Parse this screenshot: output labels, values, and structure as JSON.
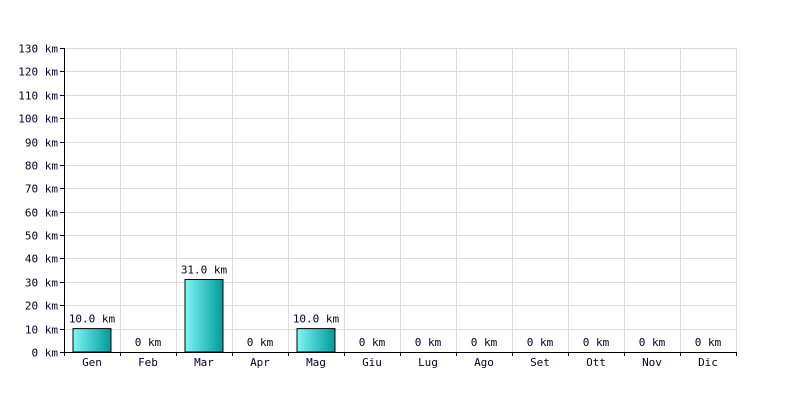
{
  "chart_data": {
    "type": "bar",
    "categories": [
      "Gen",
      "Feb",
      "Mar",
      "Apr",
      "Mag",
      "Giu",
      "Lug",
      "Ago",
      "Set",
      "Ott",
      "Nov",
      "Dic"
    ],
    "values": [
      10.0,
      0,
      31.0,
      0,
      10.0,
      0,
      0,
      0,
      0,
      0,
      0,
      0
    ],
    "value_labels": [
      "10.0 km",
      "0 km",
      "31.0 km",
      "0 km",
      "10.0 km",
      "0 km",
      "0 km",
      "0 km",
      "0 km",
      "0 km",
      "0 km",
      "0 km"
    ],
    "y_ticks": [
      0,
      10,
      20,
      30,
      40,
      50,
      60,
      70,
      80,
      90,
      100,
      110,
      120,
      130
    ],
    "y_tick_labels": [
      "0 km",
      "10 km",
      "20 km",
      "30 km",
      "40 km",
      "50 km",
      "60 km",
      "70 km",
      "80 km",
      "90 km",
      "100 km",
      "110 km",
      "120 km",
      "130 km"
    ],
    "ylim": [
      0,
      130
    ],
    "grid": true,
    "title": "",
    "xlabel": "",
    "ylabel": "",
    "colors": {
      "bar_light": "#7ff5f5",
      "bar_dark": "#009b9b",
      "bar_edge": "#000000",
      "grid": "#dcdcdc",
      "text": "#000033"
    }
  }
}
